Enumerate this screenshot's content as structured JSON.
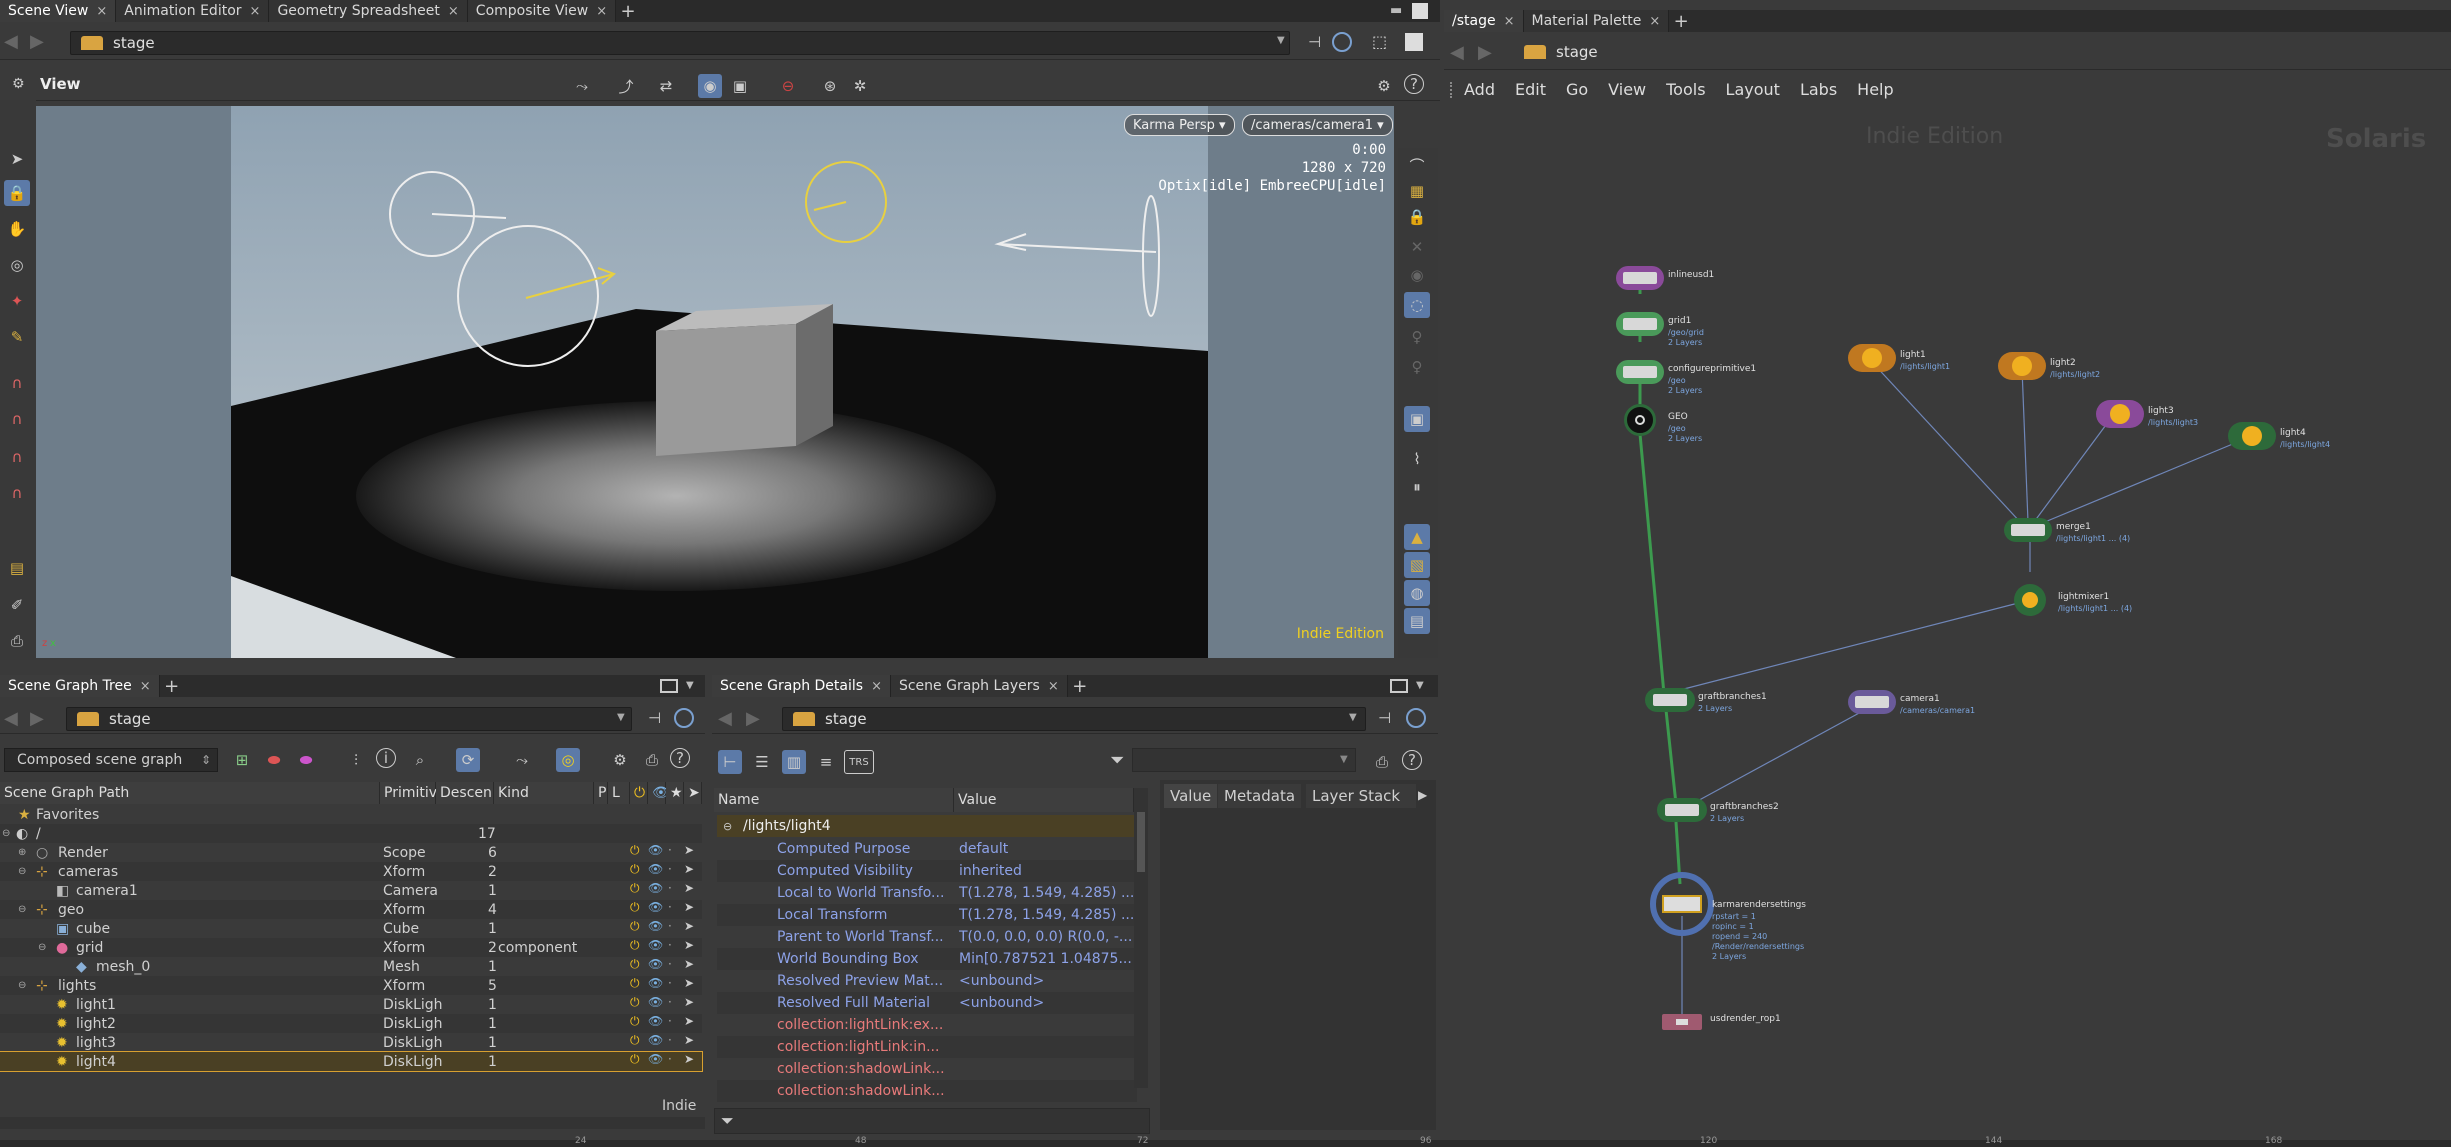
{
  "left_tabs": {
    "items": [
      "Scene View",
      "Animation Editor",
      "Geometry Spreadsheet",
      "Composite View"
    ]
  },
  "right_tabs": {
    "items": [
      "/stage",
      "Material Palette"
    ]
  },
  "left_path": "stage",
  "right_path": "stage",
  "viewport": {
    "title": "View",
    "renderer": "Karma Persp",
    "camera": "/cameras/camera1",
    "time": "0:00",
    "resolution": "1280 x 720",
    "status": "Optix[idle] EmbreeCPU[idle]",
    "edition": "Indie Edition"
  },
  "network": {
    "menu": [
      "Add",
      "Edit",
      "Go",
      "View",
      "Tools",
      "Layout",
      "Labs",
      "Help"
    ],
    "edition": "Indie Edition",
    "context": "Solaris",
    "nodes": [
      {
        "name": "inlineusd1",
        "sub": ""
      },
      {
        "name": "grid1",
        "sub": "/geo/grid\n2 Layers"
      },
      {
        "name": "configureprimitive1",
        "sub": "/geo\n2 Layers"
      },
      {
        "name": "GEO",
        "sub": "/geo\n2 Layers"
      },
      {
        "name": "light1",
        "sub": "/lights/light1"
      },
      {
        "name": "light2",
        "sub": "/lights/light2"
      },
      {
        "name": "light3",
        "sub": "/lights/light3"
      },
      {
        "name": "light4",
        "sub": "/lights/light4"
      },
      {
        "name": "merge1",
        "sub": "/lights/light1 ... (4)"
      },
      {
        "name": "lightmixer1",
        "sub": "/lights/light1 ... (4)"
      },
      {
        "name": "graftbranches1",
        "sub": "2 Layers"
      },
      {
        "name": "camera1",
        "sub": "/cameras/camera1"
      },
      {
        "name": "graftbranches2",
        "sub": "2 Layers"
      },
      {
        "name": "karmarendersettings",
        "sub": "rpstart = 1\nropinc = 1\nropend = 240\n/Render/rendersettings\n2 Layers"
      },
      {
        "name": "usdrender_rop1",
        "sub": ""
      }
    ],
    "ruler_ticks": [
      "24",
      "48",
      "72",
      "96",
      "120",
      "144",
      "168"
    ]
  },
  "tree_tabs": {
    "items": [
      "Scene Graph Tree"
    ]
  },
  "tree_path": "stage",
  "tree_filter": "Composed scene graph",
  "tree_columns": [
    "Scene Graph Path",
    "Primitiv",
    "Descen",
    "Kind",
    "P",
    "L"
  ],
  "tree_rows": [
    {
      "name": "Favorites",
      "type": "",
      "desc": "",
      "kind": "",
      "indent": 1
    },
    {
      "name": "/",
      "type": "",
      "desc": "17",
      "kind": "",
      "indent": 0
    },
    {
      "name": "Render",
      "type": "Scope",
      "desc": "6",
      "kind": "",
      "indent": 1
    },
    {
      "name": "cameras",
      "type": "Xform",
      "desc": "2",
      "kind": "",
      "indent": 1
    },
    {
      "name": "camera1",
      "type": "Camera",
      "desc": "1",
      "kind": "",
      "indent": 2
    },
    {
      "name": "geo",
      "type": "Xform",
      "desc": "4",
      "kind": "",
      "indent": 1
    },
    {
      "name": "cube",
      "type": "Cube",
      "desc": "1",
      "kind": "",
      "indent": 2
    },
    {
      "name": "grid",
      "type": "Xform",
      "desc": "2",
      "kind": "component",
      "indent": 2
    },
    {
      "name": "mesh_0",
      "type": "Mesh",
      "desc": "1",
      "kind": "",
      "indent": 3
    },
    {
      "name": "lights",
      "type": "Xform",
      "desc": "5",
      "kind": "",
      "indent": 1
    },
    {
      "name": "light1",
      "type": "DiskLigh",
      "desc": "1",
      "kind": "",
      "indent": 2
    },
    {
      "name": "light2",
      "type": "DiskLigh",
      "desc": "1",
      "kind": "",
      "indent": 2
    },
    {
      "name": "light3",
      "type": "DiskLigh",
      "desc": "1",
      "kind": "",
      "indent": 2
    },
    {
      "name": "light4",
      "type": "DiskLigh",
      "desc": "1",
      "kind": "",
      "indent": 2
    }
  ],
  "tree_footer": "Indie",
  "details_tabs": {
    "items": [
      "Scene Graph Details",
      "Scene Graph Layers"
    ]
  },
  "details_path": "stage",
  "details_columns": {
    "name": "Name",
    "value": "Value"
  },
  "details_header": "/lights/light4",
  "details_rows": [
    {
      "name": "Computed Purpose",
      "value": "default",
      "kind": "attr"
    },
    {
      "name": "Computed Visibility",
      "value": "inherited",
      "kind": "attr"
    },
    {
      "name": "Local to World Transfo...",
      "value": "T(1.278, 1.549, 4.285) ...",
      "kind": "attr"
    },
    {
      "name": "Local Transform",
      "value": "T(1.278, 1.549, 4.285) ...",
      "kind": "attr"
    },
    {
      "name": "Parent to World Transf...",
      "value": "T(0.0, 0.0, 0.0) R(0.0, -...",
      "kind": "attr"
    },
    {
      "name": "World Bounding Box",
      "value": "Min[0.787521 1.04875...",
      "kind": "attr"
    },
    {
      "name": "Resolved Preview Mat...",
      "value": "<unbound>",
      "kind": "attr"
    },
    {
      "name": "Resolved Full Material",
      "value": "<unbound>",
      "kind": "attr"
    },
    {
      "name": "collection:lightLink:ex...",
      "value": "",
      "kind": "rel"
    },
    {
      "name": "collection:lightLink:in...",
      "value": "",
      "kind": "rel"
    },
    {
      "name": "collection:shadowLink...",
      "value": "",
      "kind": "rel"
    },
    {
      "name": "collection:shadowLink...",
      "value": "",
      "kind": "rel"
    }
  ],
  "details_side_tabs": [
    "Value",
    "Metadata",
    "Layer Stack"
  ],
  "colors": {
    "accent": "#5c7aa8",
    "selection": "#d8a030",
    "attr": "#8da2e8",
    "rel": "#e87a7a"
  }
}
